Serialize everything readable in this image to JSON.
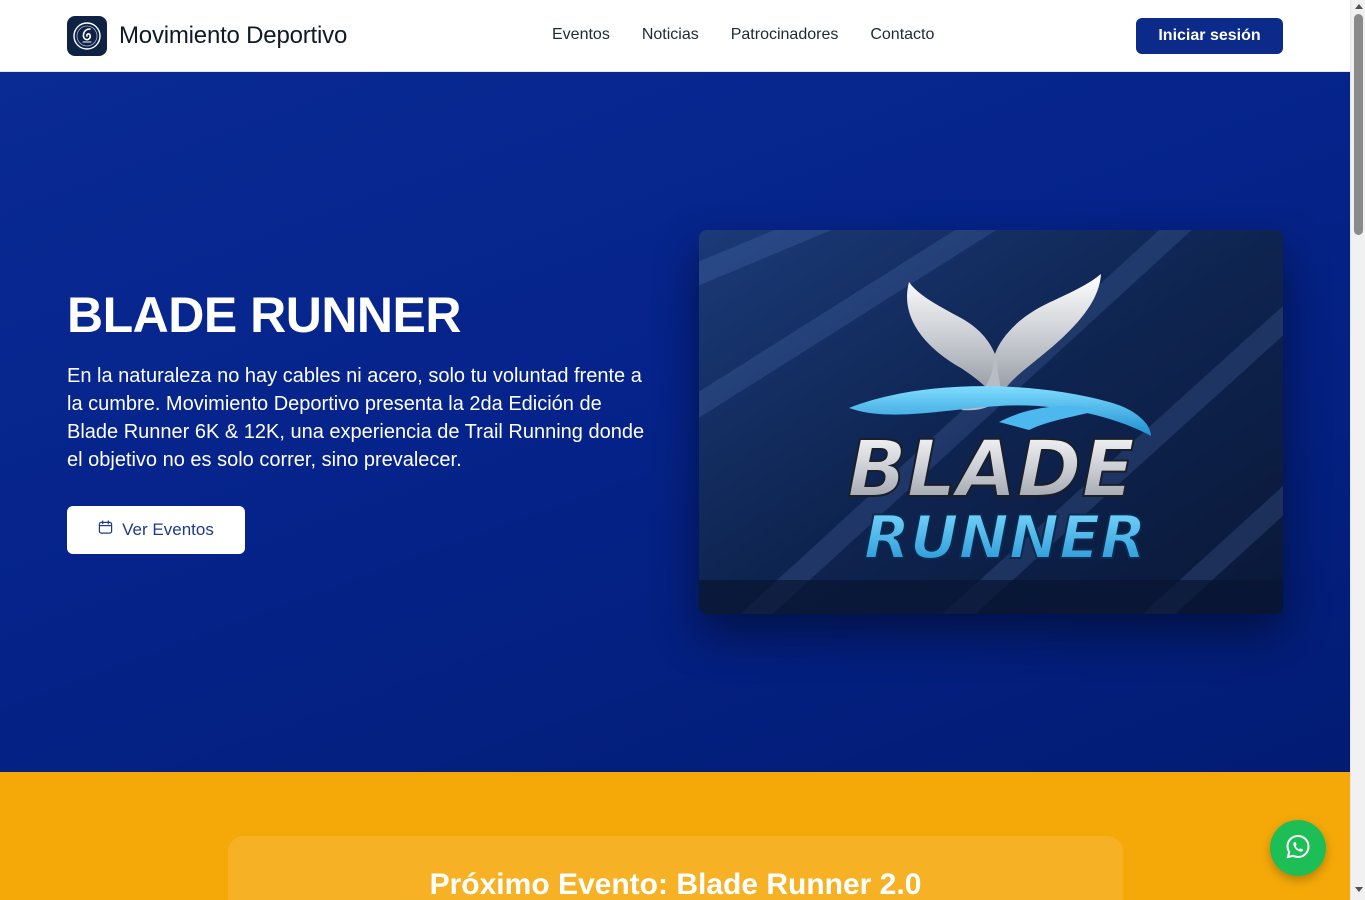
{
  "header": {
    "brand_name": "Movimiento Deportivo",
    "nav": [
      "Eventos",
      "Noticias",
      "Patrocinadores",
      "Contacto"
    ],
    "login_label": "Iniciar sesión"
  },
  "hero": {
    "title": "BLADE RUNNER",
    "description": "En la naturaleza no hay cables ni acero, solo tu voluntad frente a la cumbre. Movimiento Deportivo presenta la 2da Edición de Blade Runner 6K & 12K, una experiencia de Trail Running donde el objetivo no es solo correr, sino prevalecer.",
    "button_label": "Ver Eventos",
    "button_icon": "calendar-icon",
    "image": {
      "line1": "BLADE",
      "line2": "RUNNER"
    }
  },
  "next_event": {
    "title": "Próximo Evento: Blade Runner 2.0"
  },
  "floating": {
    "icon": "whatsapp-icon"
  },
  "colors": {
    "primary": "#0b2a8a",
    "hero_bg": "#05238a",
    "accent_yellow": "#f5a909",
    "whatsapp_green": "#1ebe57"
  }
}
